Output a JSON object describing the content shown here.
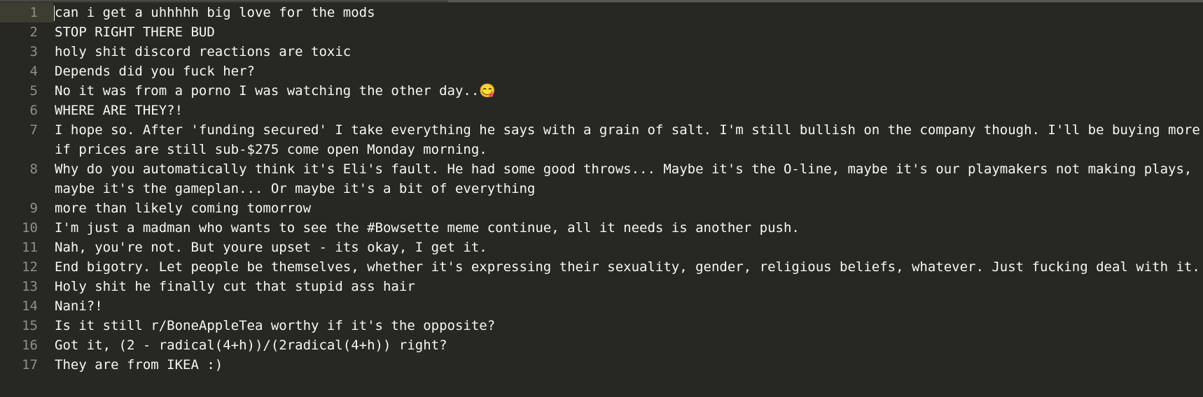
{
  "editor": {
    "lines": [
      {
        "number": "1",
        "text": "can i get a uhhhhh big love for the mods"
      },
      {
        "number": "2",
        "text": "STOP RIGHT THERE BUD"
      },
      {
        "number": "3",
        "text": "holy shit discord reactions are toxic"
      },
      {
        "number": "4",
        "text": "Depends did you fuck her?"
      },
      {
        "number": "5",
        "text": "No it was from a porno I was watching the other day..😋"
      },
      {
        "number": "6",
        "text": "WHERE ARE THEY?!"
      },
      {
        "number": "7",
        "text": "I hope so. After 'funding secured' I take everything he says with a grain of salt. I'm still bullish on the company though. I'll be buying more if prices are still sub-$275 come open Monday morning."
      },
      {
        "number": "8",
        "text": "Why do you automatically think it's Eli's fault. He had some good throws... Maybe it's the O-line, maybe it's our playmakers not making plays, maybe it's the gameplan... Or maybe it's a bit of everything"
      },
      {
        "number": "9",
        "text": "more than likely coming tomorrow"
      },
      {
        "number": "10",
        "text": "I'm just a madman who wants to see the #Bowsette meme continue, all it needs is another push."
      },
      {
        "number": "11",
        "text": "Nah, you're not. But youre upset - its okay, I get it."
      },
      {
        "number": "12",
        "text": "End bigotry. Let people be themselves, whether it's expressing their sexuality, gender, religious beliefs, whatever. Just fucking deal with it."
      },
      {
        "number": "13",
        "text": "Holy shit he finally cut that stupid ass hair"
      },
      {
        "number": "14",
        "text": "Nani?!"
      },
      {
        "number": "15",
        "text": "Is it still r/BoneAppleTea worthy if it's the opposite?"
      },
      {
        "number": "16",
        "text": "Got it, (2 - radical(4+h))/(2radical(4+h)) right?"
      },
      {
        "number": "17",
        "text": "They are from IKEA :)"
      }
    ]
  }
}
